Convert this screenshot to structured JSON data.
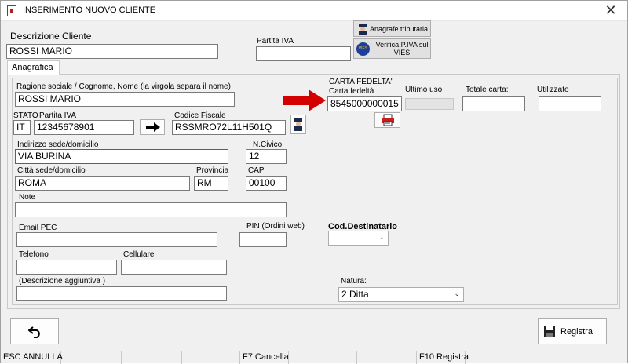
{
  "window": {
    "title": "INSERIMENTO NUOVO CLIENTE",
    "close": "✕"
  },
  "header": {
    "descrizione_label": "Descrizione Cliente",
    "descrizione_value": "ROSSI MARIO",
    "piva_label": "Partita IVA",
    "piva_value": "",
    "anagrafe_btn": "Anagrafe tributaria",
    "vies_btn": "Verifica P.IVA sul VIES",
    "vies_badge": "VIES"
  },
  "tabs": {
    "anagrafica": "Anagrafica"
  },
  "form": {
    "ragione_label": "Ragione sociale / Cognome, Nome  (la virgola separa il nome)",
    "ragione_value": "ROSSI MARIO",
    "stato_label": "STATO",
    "stato_value": "IT",
    "piva_label": "Partita IVA",
    "piva_value": "12345678901",
    "cf_label": "Codice Fiscale",
    "cf_value": "RSSMRO72L11H501Q",
    "indirizzo_label": "Indirizzo sede/domicilio",
    "indirizzo_value": "VIA BURINA",
    "ncivico_label": "N.Civico",
    "ncivico_value": "12",
    "citta_label": "Città  sede/domicilio",
    "citta_value": "ROMA",
    "provincia_label": "Provincia",
    "provincia_value": "RM",
    "cap_label": "CAP",
    "cap_value": "00100",
    "note_label": "Note",
    "note_value": "",
    "email_label": "Email PEC",
    "email_value": "",
    "pin_label": "PIN (Ordini web)",
    "pin_value": "",
    "coddest_label": "Cod.Destinatario",
    "coddest_value": "",
    "telefono_label": "Telefono",
    "telefono_value": "",
    "cellulare_label": "Cellulare",
    "cellulare_value": "",
    "descagg_label": "(Descrizione aggiuntiva )",
    "descagg_value": "",
    "natura_label": "Natura:",
    "natura_value": "2 Ditta"
  },
  "fedelta": {
    "section_label": "CARTA FEDELTA'",
    "carta_label": "Carta fedeltà",
    "carta_value": "8545000000015",
    "ultimo_label": "Ultimo uso",
    "ultimo_value": "",
    "totale_label": "Totale carta:",
    "totale_value": "",
    "utilizzato_label": "Utilizzato",
    "utilizzato_value": ""
  },
  "footer": {
    "registra": "Registra"
  },
  "statusbar": {
    "esc": "ESC ANNULLA",
    "f7": "F7 Cancella",
    "f10": "F10 Registra"
  },
  "colors": {
    "accent_red": "#d40000",
    "focus_blue": "#0078d7"
  }
}
